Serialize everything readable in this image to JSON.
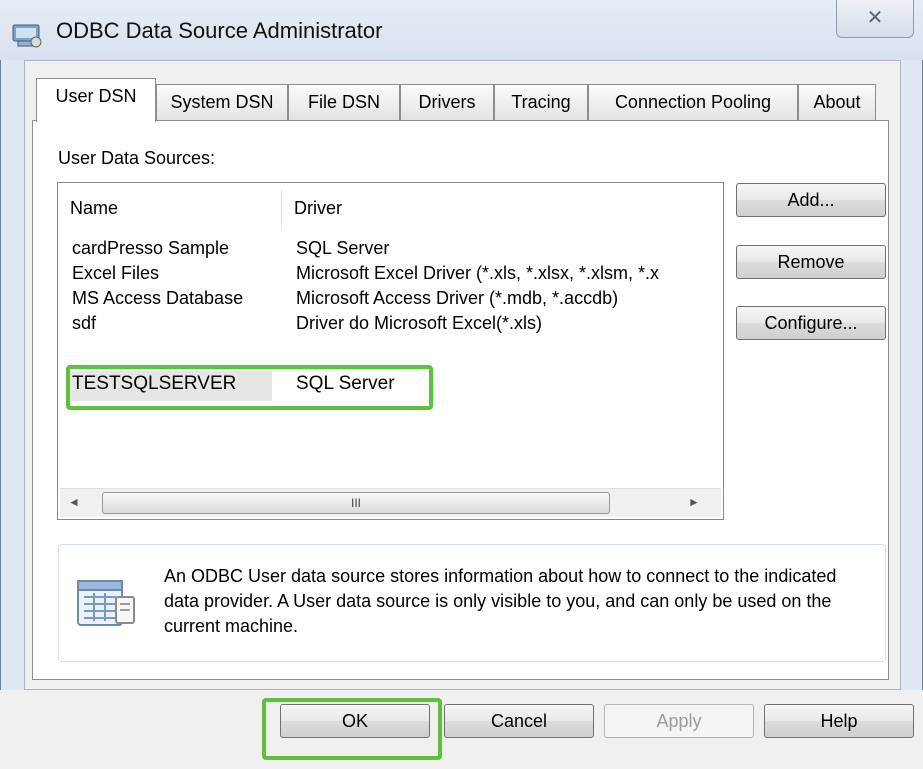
{
  "window": {
    "title": "ODBC Data Source Administrator",
    "close_glyph": "✕"
  },
  "tabs": [
    {
      "label": "User DSN",
      "active": true
    },
    {
      "label": "System DSN",
      "active": false
    },
    {
      "label": "File DSN",
      "active": false
    },
    {
      "label": "Drivers",
      "active": false
    },
    {
      "label": "Tracing",
      "active": false
    },
    {
      "label": "Connection Pooling",
      "active": false
    },
    {
      "label": "About",
      "active": false
    }
  ],
  "panel": {
    "section_label": "User Data Sources:",
    "columns": [
      "Name",
      "Driver"
    ],
    "rows": [
      {
        "name": "cardPresso Sample",
        "driver": "SQL Server"
      },
      {
        "name": "Excel Files",
        "driver": "Microsoft Excel Driver (*.xls, *.xlsx, *.xlsm, *.x"
      },
      {
        "name": "MS Access Database",
        "driver": "Microsoft Access Driver (*.mdb, *.accdb)"
      },
      {
        "name": "sdf",
        "driver": "Driver do Microsoft Excel(*.xls)"
      },
      {
        "name": "TESTSQLSERVER",
        "driver": "SQL Server"
      }
    ],
    "scrollbar": {
      "left_arrow": "◄",
      "right_arrow": "►",
      "thumb_grip": "III"
    },
    "side_buttons": {
      "add": "Add...",
      "remove": "Remove",
      "configure": "Configure..."
    },
    "info": {
      "icon": "data-source-icon",
      "text": "An ODBC User data source stores information about how to connect to the indicated data provider.   A User data source is only visible to you, and can only be used on the current machine."
    }
  },
  "footer_buttons": {
    "ok": "OK",
    "cancel": "Cancel",
    "apply": "Apply",
    "help": "Help"
  },
  "colors": {
    "highlight": "#5cc13c",
    "selection": "#e6e6e6",
    "disabled_text": "#9c9c9c"
  }
}
